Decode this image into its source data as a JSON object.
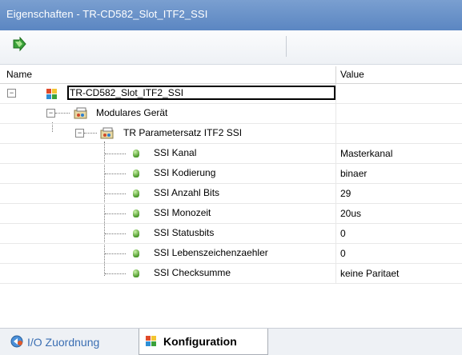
{
  "window": {
    "title": "Eigenschaften - TR-CD582_Slot_ITF2_SSI"
  },
  "columns": {
    "name": "Name",
    "value": "Value"
  },
  "tree": {
    "root": {
      "expander": "−",
      "label": "TR-CD582_Slot_ITF2_SSI",
      "value": ""
    },
    "group1": {
      "expander": "−",
      "label": "Modulares Gerät",
      "value": ""
    },
    "group2": {
      "expander": "−",
      "label": "TR Parametersatz ITF2 SSI",
      "value": ""
    },
    "items": [
      {
        "name": "SSI Kanal",
        "value": "Masterkanal"
      },
      {
        "name": "SSI Kodierung",
        "value": "binaer"
      },
      {
        "name": "SSI Anzahl Bits",
        "value": "29"
      },
      {
        "name": "SSI Monozeit",
        "value": "20us"
      },
      {
        "name": "SSI Statusbits",
        "value": "0"
      },
      {
        "name": "SSI Lebenszeichenzaehler",
        "value": "0"
      },
      {
        "name": "SSI Checksumme",
        "value": "keine Paritaet"
      }
    ]
  },
  "tabs": [
    {
      "label": "I/O Zuordnung",
      "icon": "io-mapping-icon",
      "active": false
    },
    {
      "label": "Konfiguration",
      "icon": "config-icon",
      "active": true
    }
  ],
  "colors": {
    "titlebar": "#5b86c2",
    "leaf": "#4f9a2e",
    "tab_link": "#3b6fb3"
  }
}
